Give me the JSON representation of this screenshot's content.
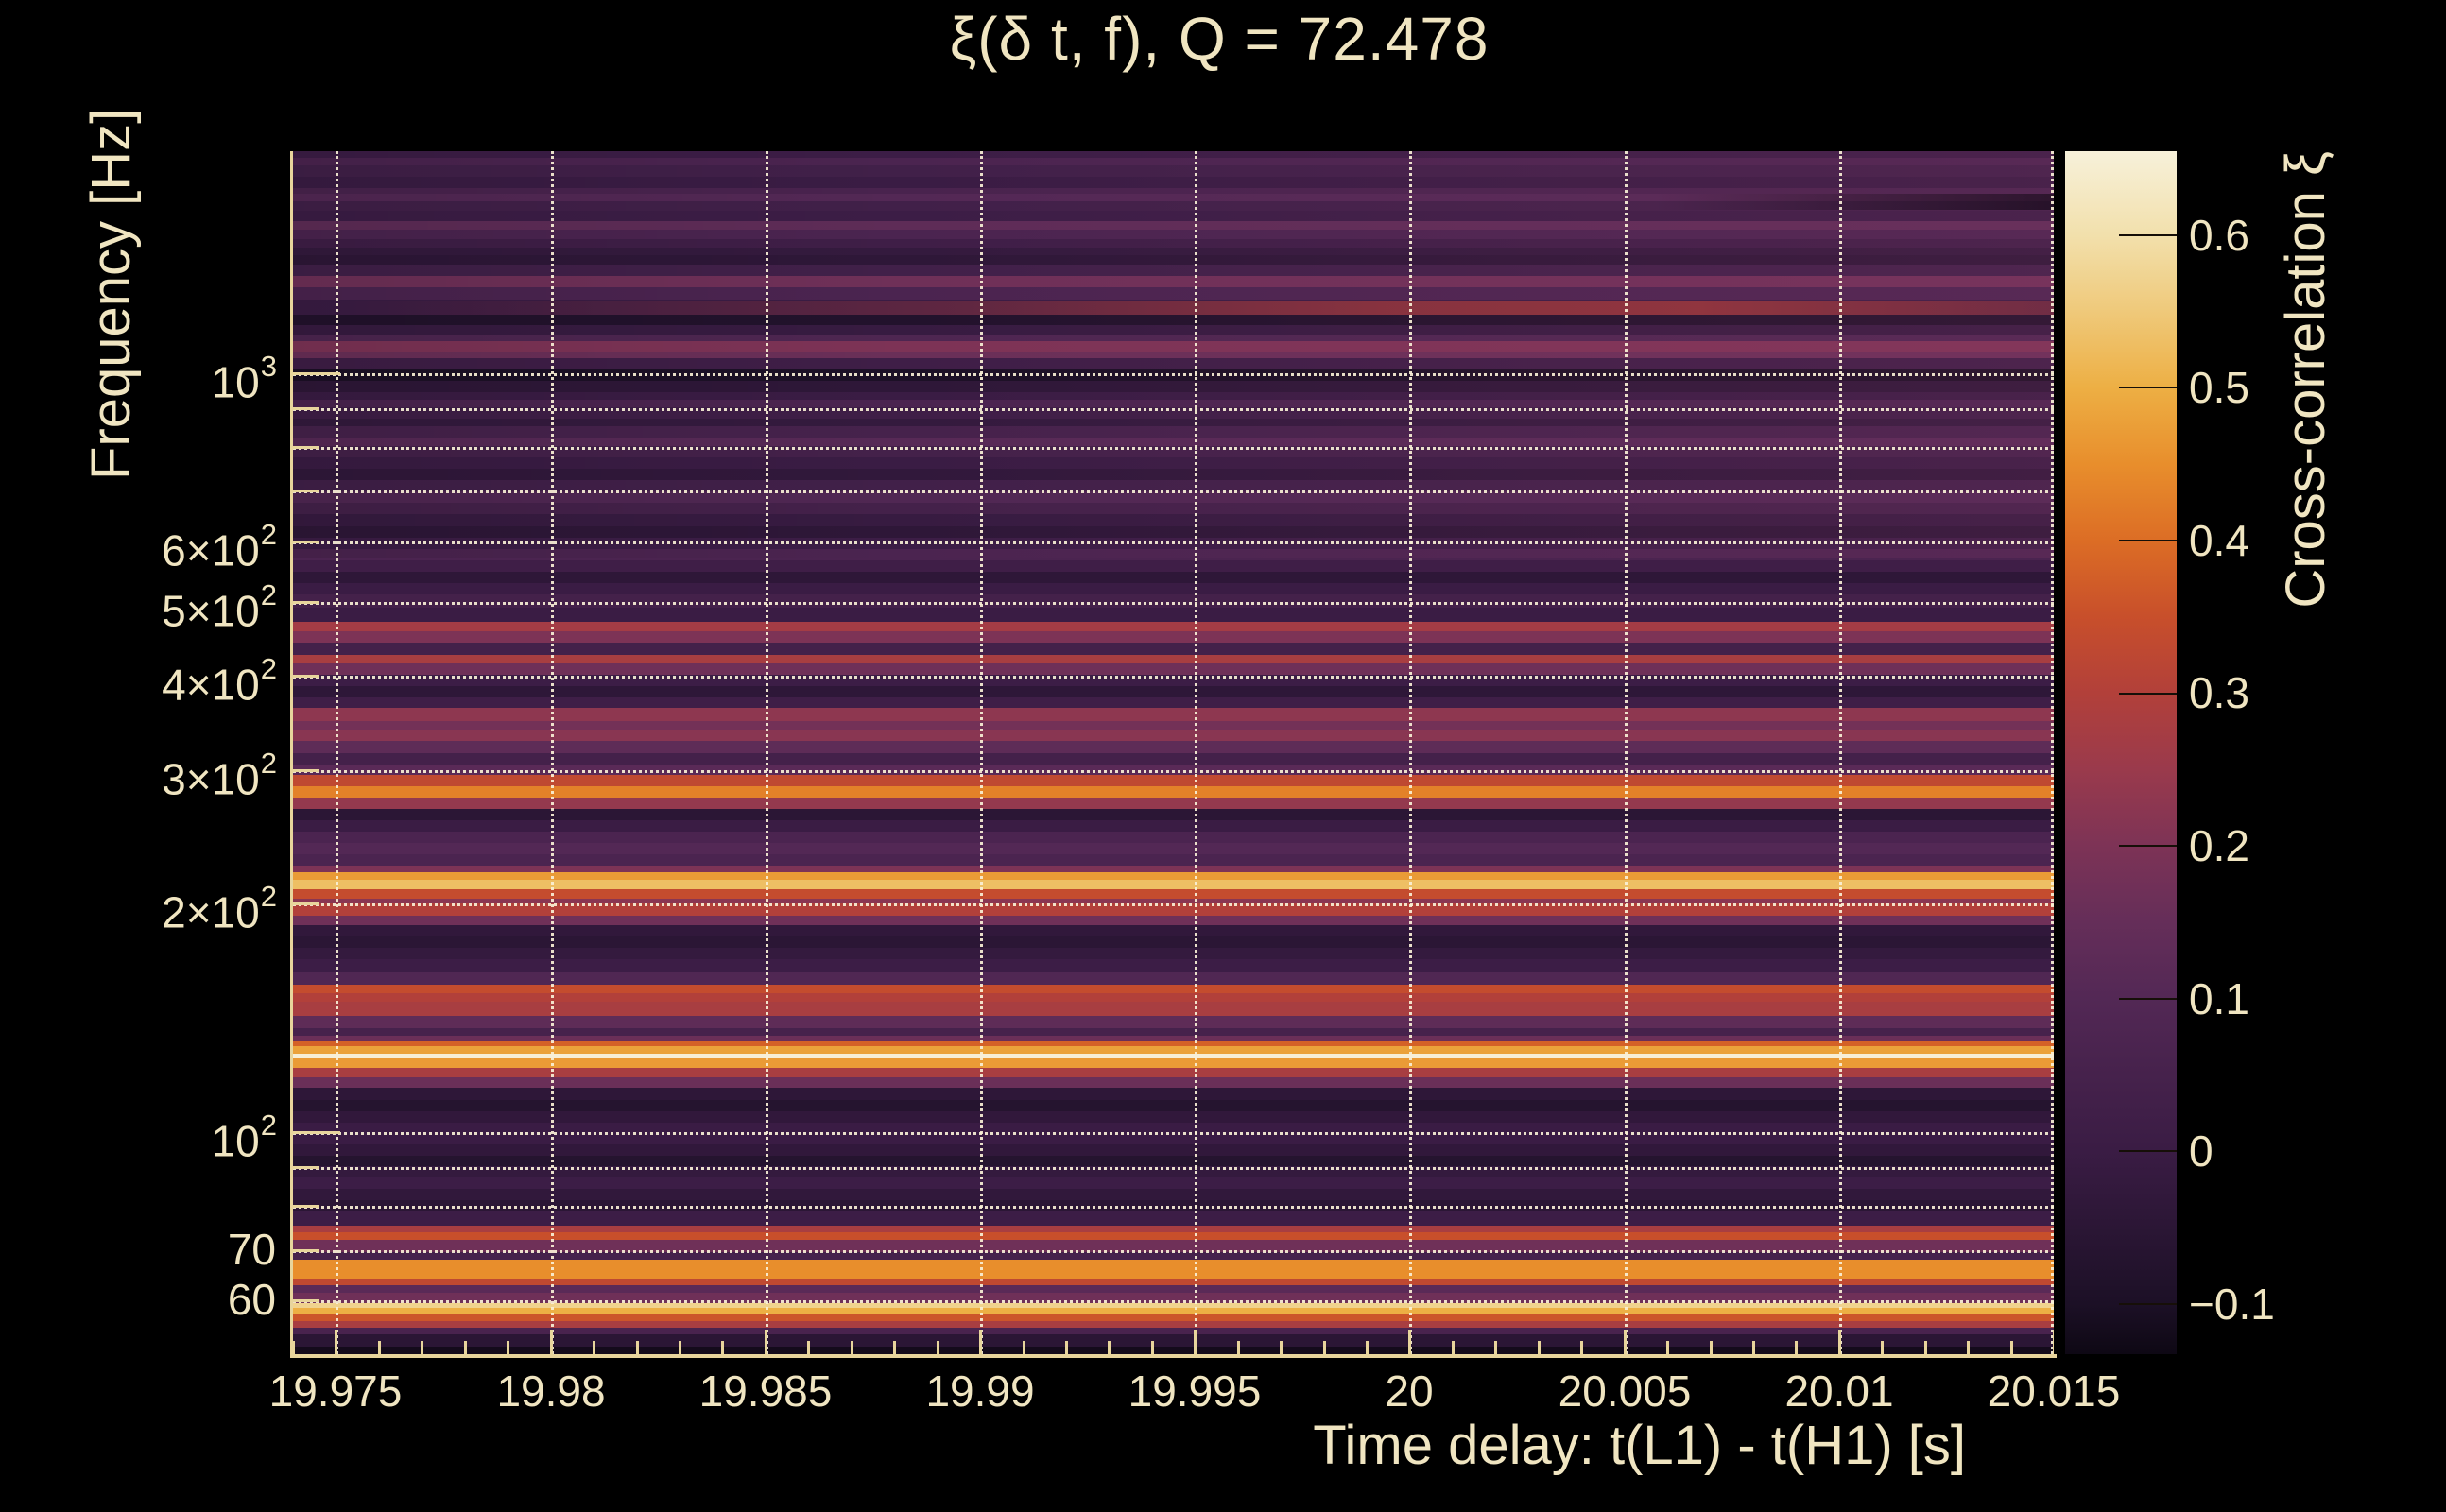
{
  "title": "ξ(δ t, f), Q = 72.478",
  "axes": {
    "x": {
      "title": "Time delay: t(L1) - t(H1) [s]",
      "min": 19.974,
      "max": 20.015,
      "minor_step": 0.001,
      "ticks": [
        {
          "v": 19.975,
          "label": "19.975"
        },
        {
          "v": 19.98,
          "label": "19.98"
        },
        {
          "v": 19.985,
          "label": "19.985"
        },
        {
          "v": 19.99,
          "label": "19.99"
        },
        {
          "v": 19.995,
          "label": "19.995"
        },
        {
          "v": 20,
          "label": "20"
        },
        {
          "v": 20.005,
          "label": "20.005"
        },
        {
          "v": 20.01,
          "label": "20.01"
        },
        {
          "v": 20.015,
          "label": "20.015"
        }
      ]
    },
    "y": {
      "title": "Frequency [Hz]",
      "scale": "log",
      "min": 51,
      "max": 1961,
      "ticks": [
        {
          "v": 1000,
          "base": "10",
          "exp": "3"
        },
        {
          "v": 600,
          "base": "6×10",
          "exp": "2"
        },
        {
          "v": 500,
          "base": "5×10",
          "exp": "2"
        },
        {
          "v": 400,
          "base": "4×10",
          "exp": "2"
        },
        {
          "v": 300,
          "base": "3×10",
          "exp": "2"
        },
        {
          "v": 200,
          "base": "2×10",
          "exp": "2"
        },
        {
          "v": 100,
          "base": "10",
          "exp": "2"
        },
        {
          "v": 70,
          "base": "70",
          "exp": ""
        },
        {
          "v": 60,
          "base": "60",
          "exp": ""
        }
      ],
      "grid": [
        60,
        70,
        80,
        90,
        100,
        200,
        300,
        400,
        500,
        600,
        700,
        800,
        900,
        1000
      ],
      "major": [
        100,
        1000
      ]
    },
    "z": {
      "title": "Cross-correlation ξ",
      "min": -0.133,
      "max": 0.655,
      "ticks": [
        {
          "v": 0.6,
          "label": "0.6"
        },
        {
          "v": 0.5,
          "label": "0.5"
        },
        {
          "v": 0.4,
          "label": "0.4"
        },
        {
          "v": 0.3,
          "label": "0.3"
        },
        {
          "v": 0.2,
          "label": "0.2"
        },
        {
          "v": 0.1,
          "label": "0.1"
        },
        {
          "v": 0,
          "label": "0"
        },
        {
          "v": -0.1,
          "label": "−0.1"
        }
      ]
    }
  },
  "colors": {
    "background": "#000000",
    "text": "#f0e5c1",
    "axis_line": "#e8d59c",
    "gridline": "#f8f0d6",
    "colorbar_tick": "#160f08"
  },
  "chart_data": {
    "type": "heatmap",
    "title": "ξ(δ t, f), Q = 72.478",
    "xlabel": "Time delay: t(L1) - t(H1) [s]",
    "ylabel": "Frequency [Hz]",
    "zlabel": "Cross-correlation ξ",
    "x_range": [
      19.974,
      20.015
    ],
    "y_range": [
      51,
      1961
    ],
    "z_range": [
      -0.133,
      0.655
    ],
    "y_scale": "log",
    "grid": true,
    "colormap": [
      [
        -0.133,
        "#0e0814"
      ],
      [
        -0.1,
        "#1c1026"
      ],
      [
        -0.05,
        "#2b1635"
      ],
      [
        0,
        "#3a1c44"
      ],
      [
        0.05,
        "#46224c"
      ],
      [
        0.1,
        "#532855"
      ],
      [
        0.15,
        "#652e59"
      ],
      [
        0.2,
        "#7d3356"
      ],
      [
        0.25,
        "#9a3a4c"
      ],
      [
        0.3,
        "#b2403a"
      ],
      [
        0.35,
        "#c84f2b"
      ],
      [
        0.4,
        "#dc6d25"
      ],
      [
        0.45,
        "#e88e2c"
      ],
      [
        0.5,
        "#edaf44"
      ],
      [
        0.55,
        "#efc97a"
      ],
      [
        0.6,
        "#f2e0ac"
      ],
      [
        0.655,
        "#f7f1da"
      ]
    ],
    "bands": [
      [
        50.7,
        52.4,
        -0.12
      ],
      [
        52.4,
        54.3,
        -0.05
      ],
      [
        54.3,
        55.4,
        0.06
      ],
      [
        55.4,
        56.5,
        0.28
      ],
      [
        56.5,
        57.8,
        0.36
      ],
      [
        57.8,
        58.9,
        0.5
      ],
      [
        58.9,
        59.7,
        0.57
      ],
      [
        59.7,
        61.6,
        0.17
      ],
      [
        61.6,
        63.1,
        0.12
      ],
      [
        63.1,
        64.4,
        0.33
      ],
      [
        64.4,
        68.2,
        0.45
      ],
      [
        68.2,
        69.8,
        0.05
      ],
      [
        69.8,
        72.3,
        0.17
      ],
      [
        72.3,
        74,
        0.35
      ],
      [
        74,
        75.5,
        0.28
      ],
      [
        75.5,
        78.9,
        0.01
      ],
      [
        78.9,
        81.6,
        -0.05
      ],
      [
        81.6,
        84.5,
        -0.03
      ],
      [
        84.5,
        87.5,
        0.01
      ],
      [
        87.5,
        90.6,
        -0.02
      ],
      [
        90.6,
        93.3,
        -0.07
      ],
      [
        93.3,
        96.6,
        -0.03
      ],
      [
        96.6,
        103.2,
        0
      ],
      [
        103.2,
        106.9,
        -0.03
      ],
      [
        106.9,
        110.7,
        -0.07
      ],
      [
        110.7,
        114.9,
        -0.04
      ],
      [
        114.9,
        118.3,
        0.16
      ],
      [
        118.3,
        121.8,
        0.28
      ],
      [
        121.8,
        125.3,
        0.47
      ],
      [
        125.3,
        127.2,
        0.65
      ],
      [
        127.2,
        130.2,
        0.48
      ],
      [
        130.2,
        132.1,
        0.38
      ],
      [
        132.1,
        134.4,
        0.16
      ],
      [
        134.4,
        137.5,
        0.05
      ],
      [
        137.5,
        142.8,
        0.13
      ],
      [
        142.8,
        149.1,
        0.28
      ],
      [
        149.1,
        153.1,
        0.3
      ],
      [
        153.1,
        156.7,
        0.34
      ],
      [
        156.7,
        162.7,
        0.09
      ],
      [
        162.7,
        169.4,
        0.01
      ],
      [
        169.4,
        175.4,
        -0.02
      ],
      [
        175.4,
        181.6,
        -0.05
      ],
      [
        181.6,
        188,
        -0.03
      ],
      [
        188,
        193.6,
        0.17
      ],
      [
        193.6,
        201,
        0.3
      ],
      [
        201,
        203.9,
        0.22
      ],
      [
        203.9,
        209.3,
        0.34
      ],
      [
        209.3,
        215.4,
        0.53
      ],
      [
        215.4,
        220.5,
        0.47
      ],
      [
        220.5,
        225,
        0.2
      ],
      [
        225,
        233,
        0.07
      ],
      [
        233,
        241.3,
        0.1
      ],
      [
        241.3,
        249.8,
        0.07
      ],
      [
        249.8,
        258.7,
        0
      ],
      [
        258.7,
        267.7,
        -0.05
      ],
      [
        267.7,
        276.4,
        0.24
      ],
      [
        276.4,
        286.2,
        0.43
      ],
      [
        286.2,
        296.3,
        0.33
      ],
      [
        296.3,
        305.9,
        0.12
      ],
      [
        305.9,
        316.7,
        0.04
      ],
      [
        316.7,
        328.8,
        0.13
      ],
      [
        328.8,
        340.5,
        0.22
      ],
      [
        340.5,
        349.5,
        0.18
      ],
      [
        349.5,
        362.9,
        0.23
      ],
      [
        362.9,
        374.7,
        0.02
      ],
      [
        374.7,
        388,
        -0.04
      ],
      [
        388,
        401.7,
        0.01
      ],
      [
        401.7,
        415.8,
        0.17
      ],
      [
        415.8,
        426.8,
        0.28
      ],
      [
        426.8,
        443.1,
        0.04
      ],
      [
        443.1,
        458.8,
        0.2
      ],
      [
        458.8,
        472.3,
        0.27
      ],
      [
        472.3,
        491.8,
        0
      ],
      [
        491.8,
        512.3,
        0.04
      ],
      [
        512.3,
        530.3,
        0
      ],
      [
        530.3,
        549.1,
        -0.04
      ],
      [
        549.1,
        568.6,
        0.02
      ],
      [
        568.6,
        588.6,
        0.07
      ],
      [
        588.6,
        609.4,
        0.01
      ],
      [
        609.4,
        631,
        -0.04
      ],
      [
        631,
        653.3,
        -0.01
      ],
      [
        653.3,
        676.4,
        0.04
      ],
      [
        676.4,
        700.3,
        0.09
      ],
      [
        700.3,
        725.1,
        0.03
      ],
      [
        725.1,
        750.7,
        -0.03
      ],
      [
        750.7,
        777.2,
        0
      ],
      [
        777.2,
        804.7,
        0.04
      ],
      [
        804.7,
        823.6,
        0.11
      ],
      [
        823.6,
        852.7,
        0.05
      ],
      [
        852.7,
        872.9,
        -0.02
      ],
      [
        872.9,
        903.3,
        0.02
      ],
      [
        903.3,
        924.8,
        0.07
      ],
      [
        924.8,
        946.5,
        0
      ],
      [
        946.5,
        979.9,
        -0.04
      ],
      [
        979.9,
        1014.6,
        -0.1
      ],
      [
        1014.6,
        1050.5,
        0.02
      ],
      [
        1050.5,
        1068.9,
        0.16
      ],
      [
        1068.9,
        1106.6,
        0.2
      ],
      [
        1106.6,
        1126.3,
        0.08
      ],
      [
        1126.3,
        1159.4,
        -0.01
      ],
      [
        1159.4,
        1196.8,
        -0.08
      ],
      [
        1196.8,
        1253.5,
        0
      ],
      [
        1253.5,
        1301.8,
        0.07
      ],
      [
        1301.8,
        1347.6,
        0.17
      ],
      [
        1347.6,
        1395.7,
        0.03
      ],
      [
        1395.7,
        1436.2,
        -0.04
      ],
      [
        1436.2,
        1469.8,
        -0.02
      ],
      [
        1469.8,
        1504.3,
        0.02
      ],
      [
        1504.3,
        1549,
        0.07
      ],
      [
        1549,
        1590,
        0.13
      ],
      [
        1590,
        1641.6,
        0.01
      ],
      [
        1641.6,
        1689.8,
        0.03
      ],
      [
        1689.8,
        1729.3,
        0.1
      ],
      [
        1729.3,
        1759.8,
        0.06
      ],
      [
        1759.8,
        1821.6,
        0
      ],
      [
        1821.6,
        1885.8,
        0.03
      ],
      [
        1885.8,
        1930,
        0.07
      ],
      [
        1930,
        1963.9,
        0.01
      ],
      [
        1963.9,
        2022,
        -0.05
      ]
    ]
  }
}
